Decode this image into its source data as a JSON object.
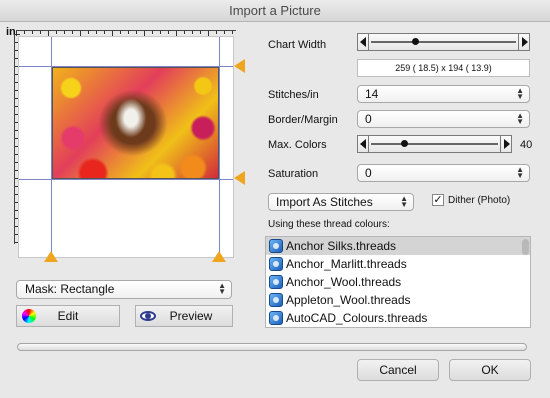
{
  "window": {
    "title": "Import a Picture"
  },
  "ruler": {
    "unit": "in"
  },
  "mask": {
    "selected": "Mask: Rectangle"
  },
  "buttons": {
    "edit": "Edit",
    "preview": "Preview",
    "cancel": "Cancel",
    "ok": "OK"
  },
  "chart_width": {
    "label": "Chart Width",
    "level": 0.3
  },
  "dimensions": "259 ( 18.5)   x 194 ( 13.9)",
  "stitches_per_in": {
    "label": "Stitches/in",
    "value": "14"
  },
  "border_margin": {
    "label": "Border/Margin",
    "value": "0"
  },
  "max_colors": {
    "label": "Max. Colors",
    "value": "40",
    "level": 0.25
  },
  "saturation": {
    "label": "Saturation",
    "value": "0"
  },
  "import_mode": {
    "value": "Import As Stitches"
  },
  "dither": {
    "label": "Dither (Photo)",
    "checked": true,
    "mark": "✓"
  },
  "thread_list": {
    "heading": "Using these thread colours:",
    "items": [
      "Anchor Silks.threads",
      "Anchor_Marlitt.threads",
      "Anchor_Wool.threads",
      "Appleton_Wool.threads",
      "AutoCAD_Colours.threads"
    ],
    "selected_index": 0
  },
  "progress": {
    "level": 0.0
  },
  "colors": {
    "handle": "#f0a51f",
    "guide": "#7e86c8",
    "accent": "#5a8ee0"
  }
}
